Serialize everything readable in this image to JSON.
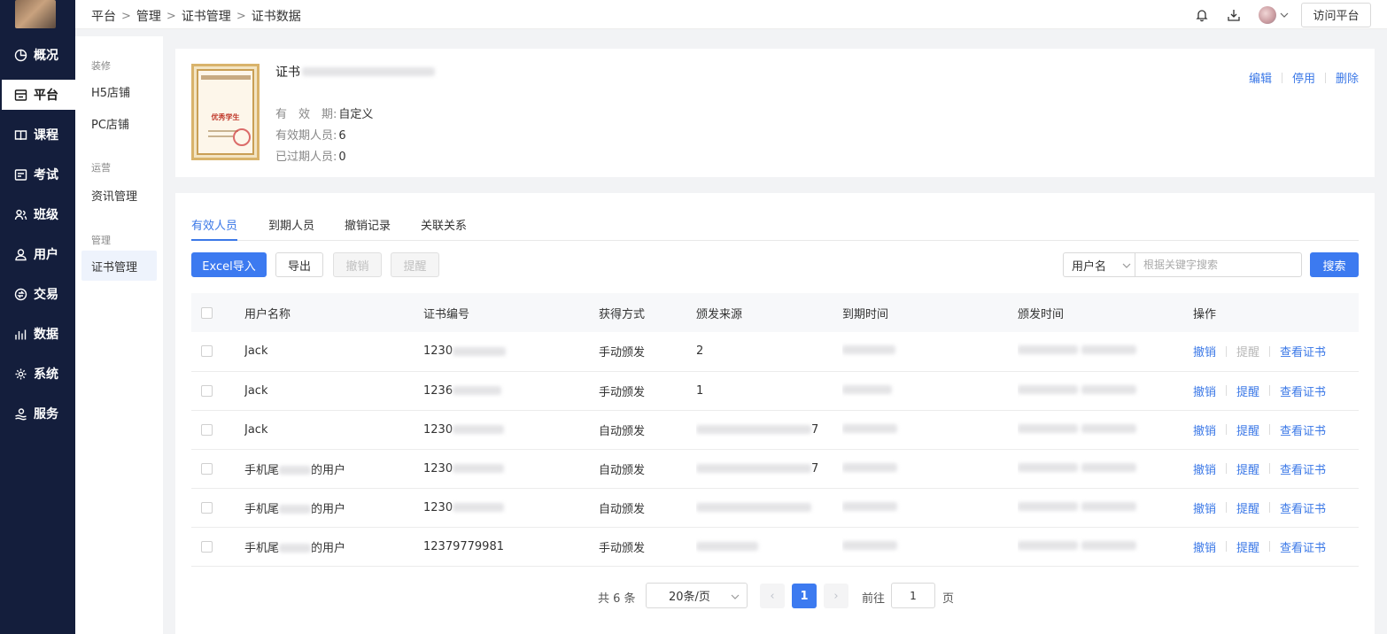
{
  "nav": {
    "items": [
      {
        "label": "概况",
        "icon": "pie-chart-icon"
      },
      {
        "label": "平台",
        "icon": "store-icon"
      },
      {
        "label": "课程",
        "icon": "book-icon"
      },
      {
        "label": "考试",
        "icon": "exam-icon"
      },
      {
        "label": "班级",
        "icon": "class-icon"
      },
      {
        "label": "用户",
        "icon": "user-icon"
      },
      {
        "label": "交易",
        "icon": "trade-icon"
      },
      {
        "label": "数据",
        "icon": "bar-chart-icon"
      },
      {
        "label": "系统",
        "icon": "gear-icon"
      },
      {
        "label": "服务",
        "icon": "service-icon"
      }
    ],
    "active_index": 1
  },
  "breadcrumb": [
    "平台",
    "管理",
    "证书管理",
    "证书数据"
  ],
  "topbar": {
    "visit_label": "访问平台"
  },
  "subnav": {
    "groups": [
      {
        "title": "装修",
        "items": [
          "H5店铺",
          "PC店铺"
        ]
      },
      {
        "title": "运营",
        "items": [
          "资讯管理"
        ]
      },
      {
        "title": "管理",
        "items": [
          "证书管理"
        ]
      }
    ]
  },
  "cert": {
    "title_prefix": "证书",
    "thumb_text": "优秀学生",
    "validity_label": "有　效　期:",
    "validity_value": "自定义",
    "valid_people_label": "有效期人员:",
    "valid_people_value": "6",
    "expired_people_label": "已过期人员:",
    "expired_people_value": "0",
    "actions": [
      "编辑",
      "停用",
      "删除"
    ]
  },
  "tabs": [
    "有效人员",
    "到期人员",
    "撤销记录",
    "关联关系"
  ],
  "toolbar": {
    "excel_import": "Excel导入",
    "export": "导出",
    "revoke": "撤销",
    "remind": "提醒",
    "search_field": "用户名",
    "search_placeholder": "根据关键字搜索",
    "search_button": "搜索"
  },
  "table": {
    "columns": [
      "用户名称",
      "证书编号",
      "获得方式",
      "颁发来源",
      "到期时间",
      "颁发时间",
      "操作"
    ],
    "rows": [
      {
        "user": "Jack",
        "user_tail": "",
        "cert_no": "1230",
        "method": "手动颁发",
        "source": "2",
        "source_tail": "",
        "remind_disabled": true
      },
      {
        "user": "Jack",
        "user_tail": "",
        "cert_no": "1236",
        "method": "手动颁发",
        "source": "1",
        "source_tail": "",
        "remind_disabled": false
      },
      {
        "user": "Jack",
        "user_tail": "",
        "cert_no": "1230",
        "method": "自动颁发",
        "source": "",
        "source_tail": "7",
        "remind_disabled": false
      },
      {
        "user": "手机尾",
        "user_tail": "的用户",
        "cert_no": "1230",
        "method": "自动颁发",
        "source": "",
        "source_tail": "7",
        "remind_disabled": false
      },
      {
        "user": "手机尾",
        "user_tail": "的用户",
        "cert_no": "1230",
        "method": "自动颁发",
        "source": "",
        "source_tail": "",
        "remind_disabled": false
      },
      {
        "user": "手机尾",
        "user_tail": "的用户",
        "cert_no": "12379779981",
        "method": "手动颁发",
        "source": "",
        "source_tail": "",
        "remind_disabled": false
      }
    ],
    "ops": {
      "revoke": "撤销",
      "remind": "提醒",
      "view": "查看证书"
    }
  },
  "pagination": {
    "total_text": "共 6 条",
    "page_size": "20条/页",
    "current_page": "1",
    "goto_label": "前往",
    "goto_value": "1",
    "page_suffix": "页"
  }
}
